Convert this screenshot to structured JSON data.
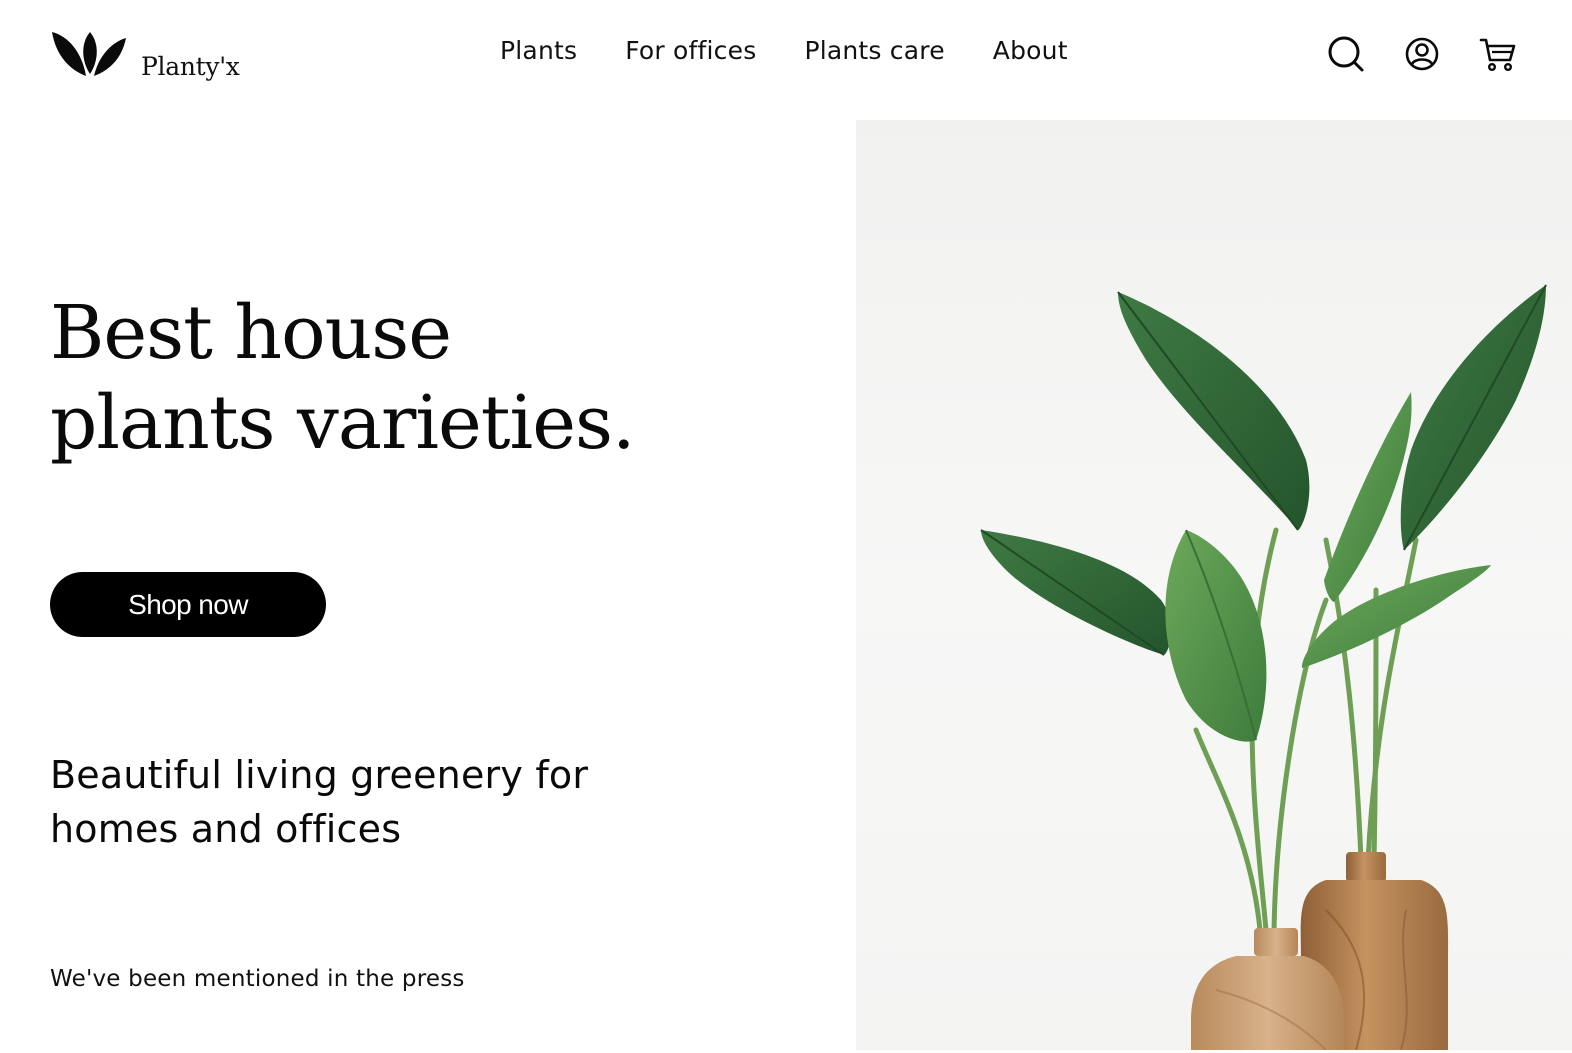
{
  "brand": {
    "name": "Planty'x",
    "logo_icon": "leaves-icon"
  },
  "nav": {
    "items": [
      {
        "label": "Plants"
      },
      {
        "label": "For offices"
      },
      {
        "label": "Plants care"
      },
      {
        "label": "About"
      }
    ]
  },
  "header_icons": [
    "search-icon",
    "user-icon",
    "cart-icon"
  ],
  "hero": {
    "title_line1": "Best house",
    "title_line2": "plants varieties.",
    "cta_label": "Shop now",
    "subtitle": "Beautiful living greenery for homes and offices",
    "press_text": "We've been mentioned in the press"
  },
  "colors": {
    "text": "#111111",
    "button_bg": "#000000",
    "button_text": "#ffffff",
    "leaf_dark": "#2f6a3a",
    "leaf_light": "#5a9a4e",
    "vase_wood": "#b98a5c"
  }
}
